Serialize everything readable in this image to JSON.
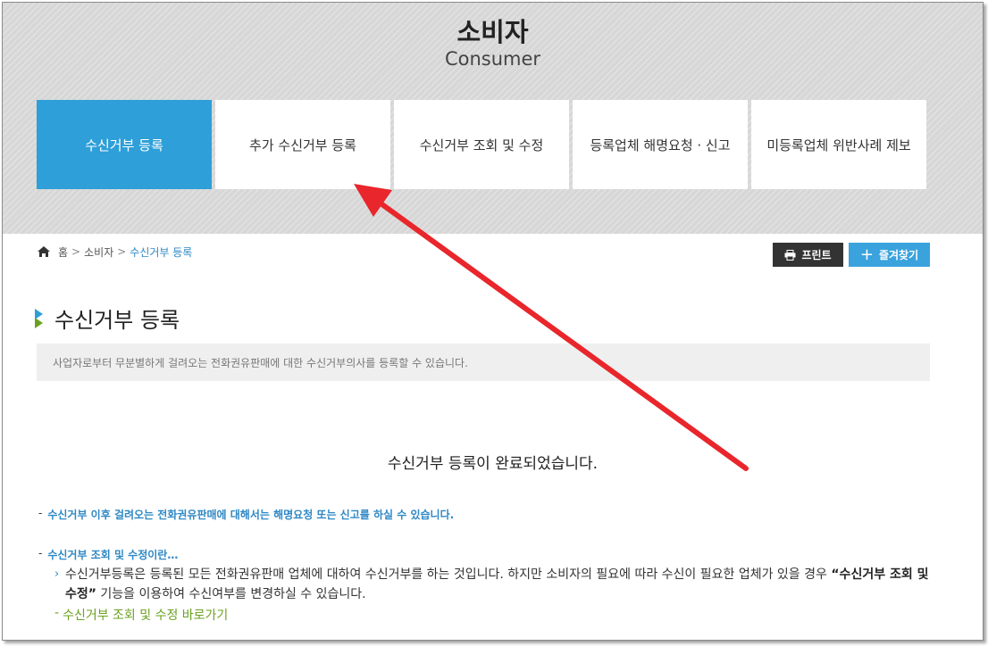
{
  "hero": {
    "title": "소비자",
    "subtitle": "Consumer"
  },
  "tabs": [
    {
      "label": "수신거부 등록",
      "active": true
    },
    {
      "label": "추가 수신거부 등록",
      "active": false
    },
    {
      "label": "수신거부 조회 및 수정",
      "active": false
    },
    {
      "label": "등록업체 해명요청 · 신고",
      "active": false
    },
    {
      "label": "미등록업체 위반사례 제보",
      "active": false
    }
  ],
  "breadcrumb": {
    "home": "홈",
    "section": "소비자",
    "current": "수신거부 등록",
    "separator": ">"
  },
  "toolbar": {
    "print_label": "프린트",
    "favorite_label": "즐겨찾기",
    "favorite_plus": "+"
  },
  "page": {
    "title": "수신거부 등록",
    "description": "사업자로부터 무분별하게 걸려오는 전화권유판매에 대한 수신거부의사를 등록할 수 있습니다.",
    "complete_message": "수신거부 등록이 완료되었습니다."
  },
  "notes": {
    "dash": "-",
    "note1": "수신거부 이후 걸려오는 전화권유판매에 대해서는 해명요청 또는 신고를 하실 수 있습니다.",
    "note2": "수신거부 조회 및 수정이란…",
    "detail_arrow": "›",
    "detail_part1": "수신거부등록은 등록된 모든 전화권유판매 업체에 대하여 수신거부를 하는 것입니다. 하지만 소비자의 필요에 따라 수신이 필요한 업체가 있을 경우 ",
    "detail_bold": "“수신거부 조회 및 수정”",
    "detail_part2": " 기능을 이용하여 수신여부를 변경하실 수 있습니다.",
    "shortcut_dash": "-",
    "shortcut_label": "수신거부 조회 및 수정 바로가기"
  },
  "colors": {
    "accent_blue": "#2e9fd8",
    "link_blue": "#2e88c5",
    "green": "#6aa120",
    "annotation_red": "#e8262b"
  }
}
